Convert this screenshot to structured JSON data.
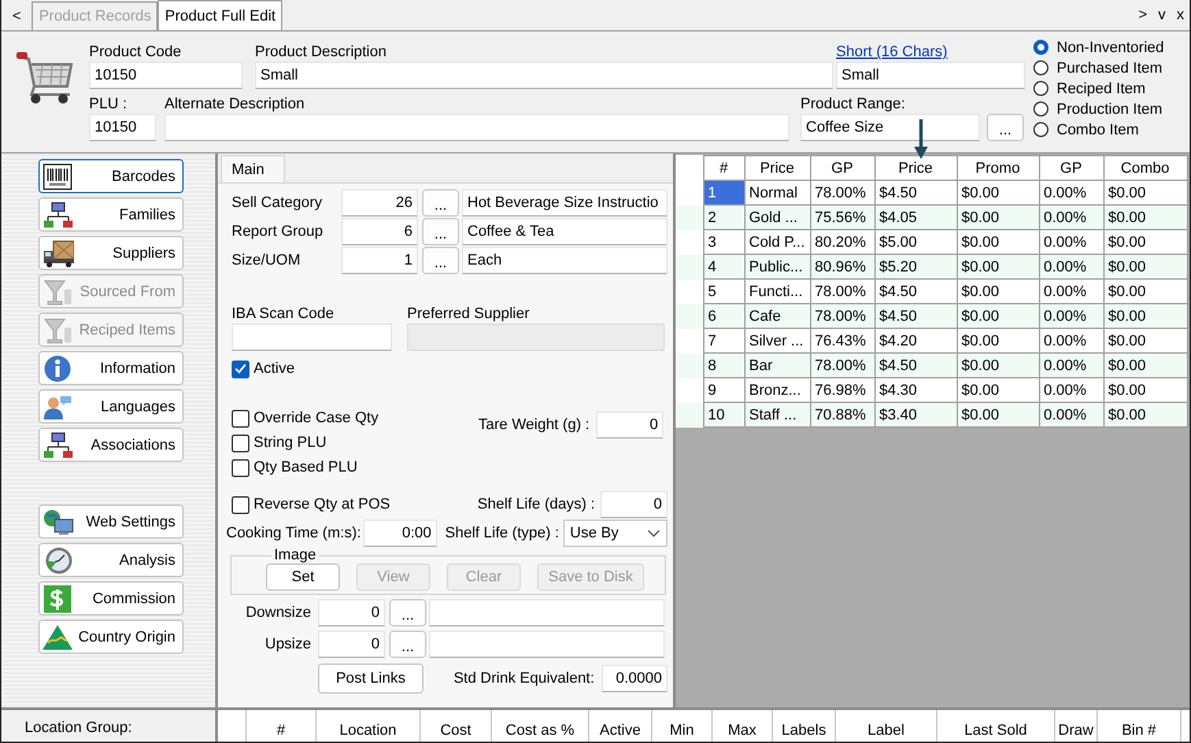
{
  "nav": {
    "back": "<",
    "forward": ">",
    "down": "v",
    "close": "x"
  },
  "tabs": [
    {
      "label": "Product Records",
      "selected": false,
      "disabled": true
    },
    {
      "label": "Product Full Edit",
      "selected": true,
      "disabled": false
    }
  ],
  "header": {
    "product_code": {
      "label": "Product Code",
      "value": "10150"
    },
    "product_description": {
      "label": "Product Description",
      "value": "Small"
    },
    "short_description": {
      "link": "Short (16 Chars)",
      "value": "Small"
    },
    "plu": {
      "label": "PLU :",
      "value": "10150"
    },
    "alternate_description": {
      "label": "Alternate Description"
    },
    "product_range": {
      "label": "Product Range:",
      "value": "Coffee Size",
      "button": "..."
    }
  },
  "item_types": [
    {
      "label": "Non-Inventoried",
      "selected": true
    },
    {
      "label": "Purchased Item",
      "selected": false
    },
    {
      "label": "Reciped Item",
      "selected": false
    },
    {
      "label": "Production Item",
      "selected": false
    },
    {
      "label": "Combo Item",
      "selected": false
    }
  ],
  "side_buttons": [
    {
      "label": "Barcodes",
      "kind": "barcode",
      "disabled": false,
      "focused": true
    },
    {
      "label": "Families",
      "kind": "network",
      "disabled": false,
      "focused": false
    },
    {
      "label": "Suppliers",
      "kind": "truck",
      "disabled": false,
      "focused": false
    },
    {
      "label": "Sourced From",
      "kind": "glass",
      "disabled": true,
      "focused": false
    },
    {
      "label": "Reciped Items",
      "kind": "glass",
      "disabled": true,
      "focused": false
    },
    {
      "label": "Information",
      "kind": "info",
      "disabled": false,
      "focused": false
    },
    {
      "label": "Languages",
      "kind": "person",
      "disabled": false,
      "focused": false
    },
    {
      "label": "Associations",
      "kind": "network",
      "disabled": false,
      "focused": false
    }
  ],
  "side_buttons_lower": [
    {
      "label": "Web Settings",
      "kind": "globe",
      "disabled": false,
      "focused": false
    },
    {
      "label": "Analysis",
      "kind": "clock",
      "disabled": false,
      "focused": false
    },
    {
      "label": "Commission",
      "kind": "dollar",
      "disabled": false,
      "focused": false
    },
    {
      "label": "Country Origin",
      "kind": "triangle",
      "disabled": false,
      "focused": false
    }
  ],
  "main_tabs": [
    {
      "label": "Main",
      "selected": true
    }
  ],
  "lookups": [
    {
      "label": "Sell Category",
      "code": "26",
      "button": "...",
      "name": "Hot Beverage Size Instructio"
    },
    {
      "label": "Report Group",
      "code": "6",
      "button": "...",
      "name": "Coffee & Tea"
    },
    {
      "label": "Size/UOM",
      "code": "1",
      "button": "...",
      "name": "Each"
    }
  ],
  "iba_scan_code": {
    "label": "IBA Scan Code"
  },
  "preferred_supplier": {
    "label": "Preferred Supplier",
    "disabled": true
  },
  "active": {
    "label": "Active",
    "checked": true
  },
  "options": [
    {
      "label": "Override Case Qty",
      "checked": false
    },
    {
      "label": "String PLU",
      "checked": false
    },
    {
      "label": "Qty Based PLU",
      "checked": false
    }
  ],
  "tare_weight": {
    "label": "Tare Weight (g) :",
    "value": "0"
  },
  "reverse_qty": {
    "label": "Reverse Qty at POS",
    "checked": false
  },
  "shelf_life_days": {
    "label": "Shelf Life (days) :",
    "value": "0"
  },
  "cooking_time": {
    "label": "Cooking Time (m:s):",
    "value": "0:00"
  },
  "shelf_life_type": {
    "label": "Shelf Life (type) :",
    "value": "Use By"
  },
  "image": {
    "title": "Image",
    "buttons": [
      {
        "label": "Set",
        "disabled": false
      },
      {
        "label": "View",
        "disabled": true
      },
      {
        "label": "Clear",
        "disabled": true
      },
      {
        "label": "Save to Disk",
        "disabled": true
      }
    ]
  },
  "sizes": [
    {
      "label": "Downsize",
      "value": "0",
      "button": "..."
    },
    {
      "label": "Upsize",
      "value": "0",
      "button": "..."
    }
  ],
  "post_links": "Post Links",
  "std_drink": {
    "label": "Std Drink Equivalent:",
    "value": "0.0000"
  },
  "price_grid": {
    "columns": [
      "#",
      "Price",
      "GP",
      "Price",
      "Promo",
      "GP",
      "Combo"
    ],
    "rows": [
      {
        "selected": true,
        "cells": [
          "1",
          "Normal",
          "78.00%",
          "$4.50",
          "$0.00",
          "0.00%",
          "$0.00"
        ]
      },
      {
        "selected": false,
        "cells": [
          "2",
          "Gold ...",
          "75.56%",
          "$4.05",
          "$0.00",
          "0.00%",
          "$0.00"
        ]
      },
      {
        "selected": false,
        "cells": [
          "3",
          "Cold P...",
          "80.20%",
          "$5.00",
          "$0.00",
          "0.00%",
          "$0.00"
        ]
      },
      {
        "selected": false,
        "cells": [
          "4",
          "Public...",
          "80.96%",
          "$5.20",
          "$0.00",
          "0.00%",
          "$0.00"
        ]
      },
      {
        "selected": false,
        "cells": [
          "5",
          "Functi...",
          "78.00%",
          "$4.50",
          "$0.00",
          "0.00%",
          "$0.00"
        ]
      },
      {
        "selected": false,
        "cells": [
          "6",
          "Cafe",
          "78.00%",
          "$4.50",
          "$0.00",
          "0.00%",
          "$0.00"
        ]
      },
      {
        "selected": false,
        "cells": [
          "7",
          "Silver ...",
          "76.43%",
          "$4.20",
          "$0.00",
          "0.00%",
          "$0.00"
        ]
      },
      {
        "selected": false,
        "cells": [
          "8",
          "Bar",
          "78.00%",
          "$4.50",
          "$0.00",
          "0.00%",
          "$0.00"
        ]
      },
      {
        "selected": false,
        "cells": [
          "9",
          "Bronz...",
          "76.98%",
          "$4.30",
          "$0.00",
          "0.00%",
          "$0.00"
        ]
      },
      {
        "selected": false,
        "cells": [
          "10",
          "Staff ...",
          "70.88%",
          "$3.40",
          "$0.00",
          "0.00%",
          "$0.00"
        ]
      }
    ]
  },
  "location_group": {
    "label": "Location Group:"
  },
  "location_grid": {
    "columns": [
      "#",
      "Location",
      "Cost",
      "Cost as %",
      "Active",
      "Min",
      "Max",
      "Labels",
      "Label",
      "Last Sold",
      "Draw",
      "Bin #"
    ]
  }
}
